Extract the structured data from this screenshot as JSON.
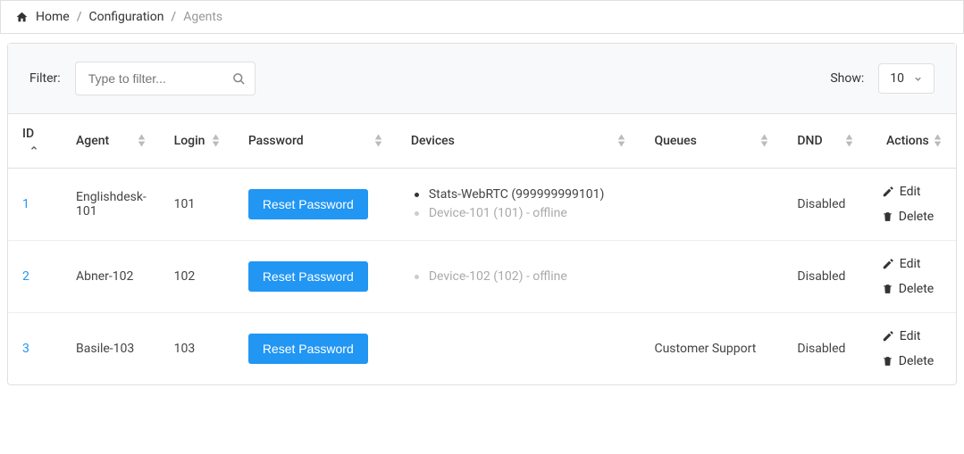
{
  "breadcrumbs": {
    "home": "Home",
    "configuration": "Configuration",
    "agents": "Agents"
  },
  "filter": {
    "label": "Filter:",
    "placeholder": "Type to filter..."
  },
  "show": {
    "label": "Show:",
    "value": "10"
  },
  "columns": {
    "id": "ID",
    "agent": "Agent",
    "login": "Login",
    "password": "Password",
    "devices": "Devices",
    "queues": "Queues",
    "dnd": "DND",
    "actions": "Actions"
  },
  "buttons": {
    "reset_password": "Reset Password",
    "edit": "Edit",
    "delete": "Delete"
  },
  "rows": [
    {
      "id": "1",
      "agent": "Englishdesk-101",
      "login": "101",
      "devices": [
        {
          "text": "Stats-WebRTC (999999999101)",
          "offline": false
        },
        {
          "text": "Device-101 (101) - offline",
          "offline": true
        }
      ],
      "queues": "",
      "dnd": "Disabled"
    },
    {
      "id": "2",
      "agent": "Abner-102",
      "login": "102",
      "devices": [
        {
          "text": "Device-102 (102) - offline",
          "offline": true
        }
      ],
      "queues": "",
      "dnd": "Disabled"
    },
    {
      "id": "3",
      "agent": "Basile-103",
      "login": "103",
      "devices": [],
      "queues": "Customer Support",
      "dnd": "Disabled"
    }
  ]
}
